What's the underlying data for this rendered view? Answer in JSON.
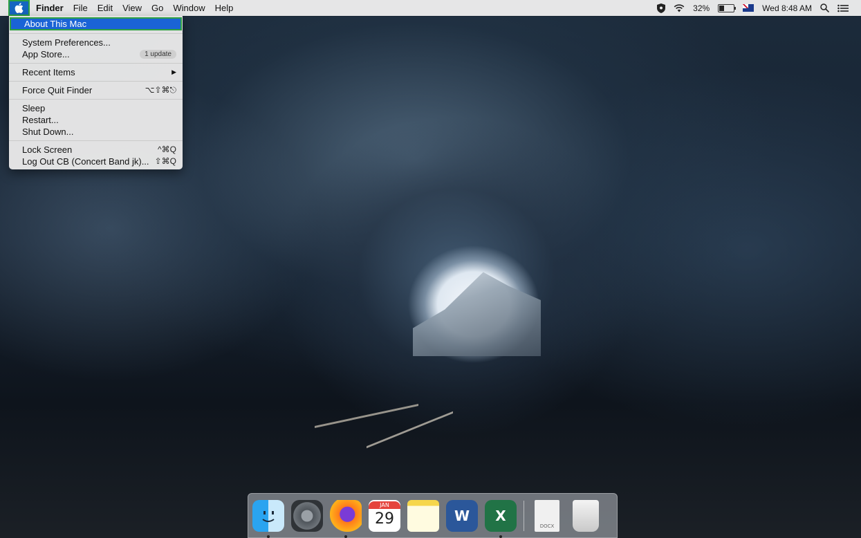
{
  "menubar": {
    "app_name": "Finder",
    "menus": [
      "File",
      "Edit",
      "View",
      "Go",
      "Window",
      "Help"
    ],
    "battery": "32%",
    "battery_level": 0.32,
    "clock": "Wed 8:48 AM"
  },
  "apple_menu": {
    "about": "About This Mac",
    "system_prefs": "System Preferences...",
    "app_store": "App Store...",
    "app_store_badge": "1 update",
    "recent_items": "Recent Items",
    "force_quit": "Force Quit Finder",
    "force_quit_shortcut": "⌥⇧⌘⎋",
    "sleep": "Sleep",
    "restart": "Restart...",
    "shut_down": "Shut Down...",
    "lock_screen": "Lock Screen",
    "lock_screen_shortcut": "^⌘Q",
    "log_out": "Log Out CB (Concert Band jk)...",
    "log_out_shortcut": "⇧⌘Q"
  },
  "dock": {
    "calendar_month": "JAN",
    "calendar_day": "29",
    "word_letter": "W",
    "excel_letter": "X",
    "doc_ext": "DOCX"
  },
  "colors": {
    "menu_highlight": "#1a63d6",
    "focus_outline": "#2ea043"
  }
}
